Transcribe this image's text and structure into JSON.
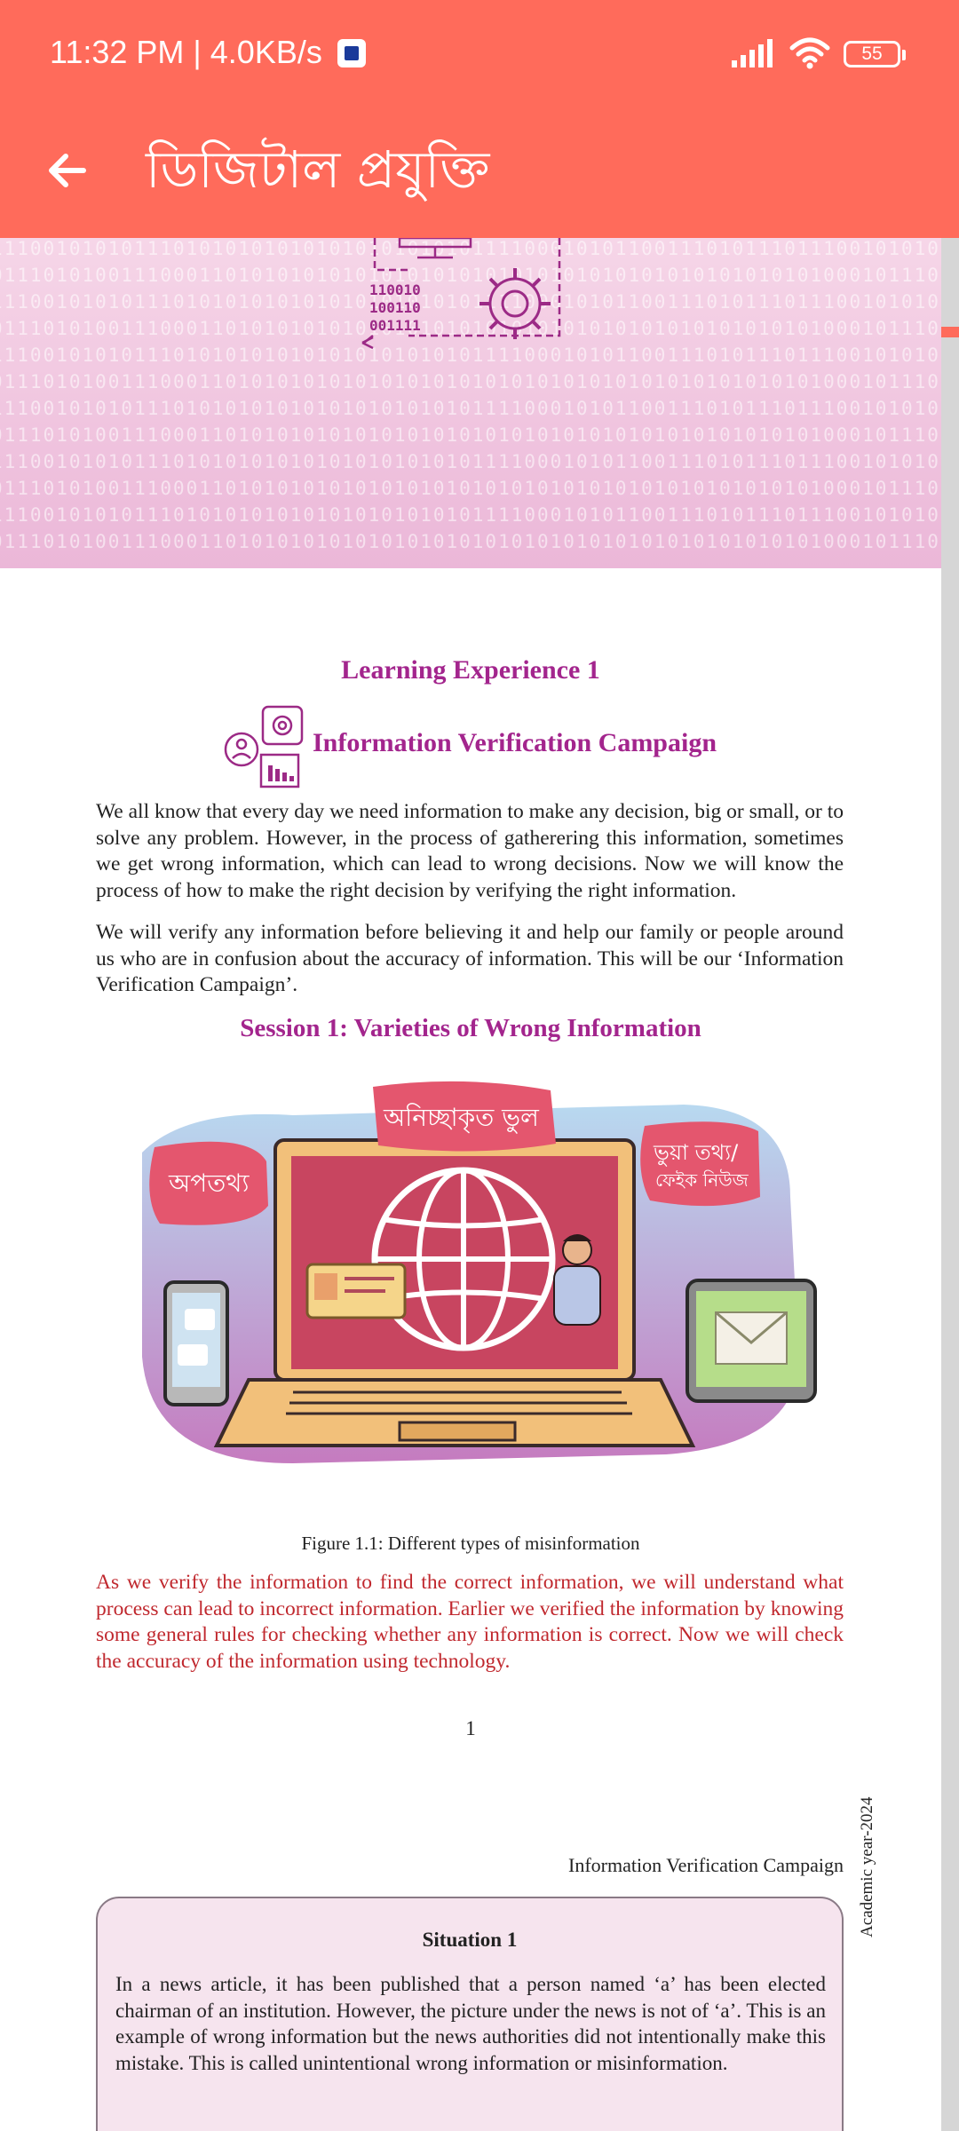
{
  "status_bar": {
    "time": "11:32 PM | 4.0KB/s",
    "battery": "55"
  },
  "app_bar": {
    "title": "ডিজিটাল প্রযুক্তি"
  },
  "banner": {
    "binary_label": "110010\n100110\n001111"
  },
  "document": {
    "learning_experience": "Learning Experience 1",
    "campaign_title": "Information Verification Campaign",
    "paragraph1": "We all know that every day we need information to make any decision, big or small, or to solve any problem. However, in the process of gatherering this information, sometimes we get wrong information, which can lead to wrong decisions. Now we will know the process of how to make the right decision by verifying the right information.",
    "paragraph2": "We will verify any information before believing it and help our family or people around us who are in confusion about the accuracy of information. This will be our ‘Information Verification Campaign’.",
    "session_title": "Session 1: Varieties of Wrong Information",
    "illustration_labels": {
      "left": "অপতথ্য",
      "center": "অনিচ্ছাকৃত ভুল",
      "right_line1": "ভুয়া তথ্য/",
      "right_line2": "ফেইক নিউজ"
    },
    "figure_caption": "Figure 1.1: Different types of misinformation",
    "red_paragraph": "As we verify the information to find the correct information, we will understand what process can lead to incorrect information. Earlier we verified the information by knowing some general rules for checking whether any information is correct. Now we will check the accuracy of the information using technology.",
    "side_note": "Academic year-2024",
    "page_number": "1",
    "next_page_header": "Information Verification Campaign",
    "situation": {
      "title": "Situation 1",
      "text": "In a news article, it has been published that a person named ‘a’ has been elected chairman of an institution. However, the picture under the news is not of ‘a’. This is an example of wrong information but the news authorities did not intentionally make this mistake. This is called unintentional wrong information or misinformation."
    }
  },
  "colors": {
    "app_bar": "#ff6b5b",
    "heading": "#a3258d",
    "red_text": "#c0282e"
  },
  "icons": [
    "back-arrow-icon",
    "signal-icon",
    "wifi-icon",
    "battery-icon",
    "gear-icon",
    "user-icon",
    "chart-icon"
  ]
}
